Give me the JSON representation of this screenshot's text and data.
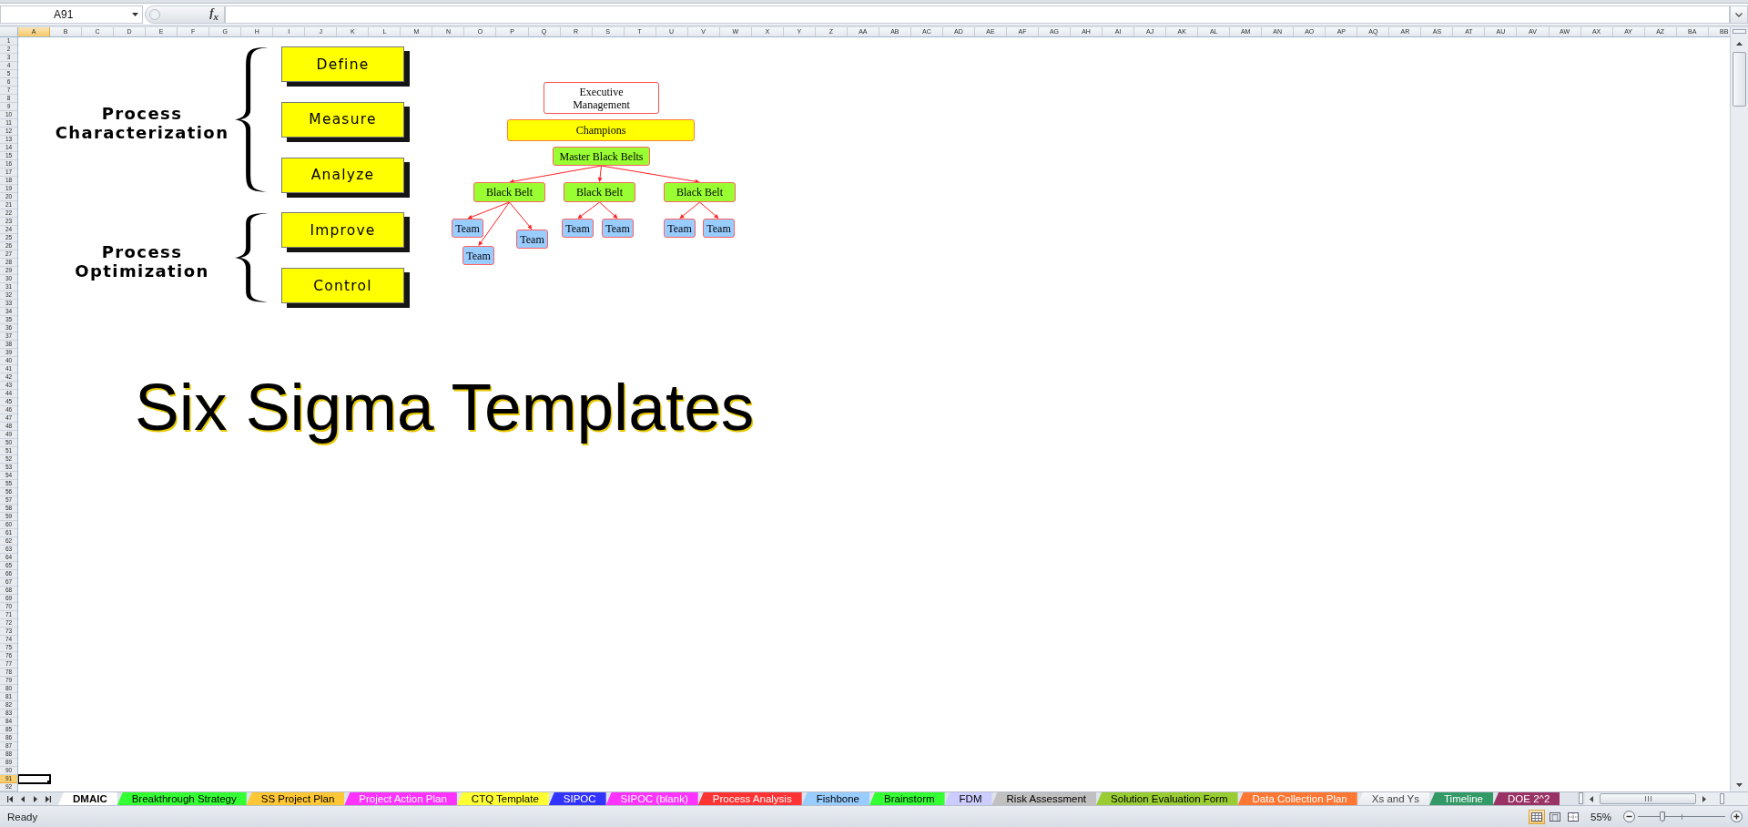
{
  "formula_bar": {
    "name_box": "A91",
    "function_button": "f$_{x}$"
  },
  "column_headers": [
    {
      "label": "A",
      "selected": true
    },
    {
      "label": "B",
      "selected": false
    },
    {
      "label": "C",
      "selected": false
    },
    {
      "label": "D",
      "selected": false
    },
    {
      "label": "E",
      "selected": false
    },
    {
      "label": "F",
      "selected": false
    },
    {
      "label": "G",
      "selected": false
    },
    {
      "label": "H",
      "selected": false
    },
    {
      "label": "I",
      "selected": false
    },
    {
      "label": "J",
      "selected": false
    },
    {
      "label": "K",
      "selected": false
    },
    {
      "label": "L",
      "selected": false
    },
    {
      "label": "M",
      "selected": false
    },
    {
      "label": "N",
      "selected": false
    },
    {
      "label": "O",
      "selected": false
    },
    {
      "label": "P",
      "selected": false
    },
    {
      "label": "Q",
      "selected": false
    },
    {
      "label": "R",
      "selected": false
    },
    {
      "label": "S",
      "selected": false
    },
    {
      "label": "T",
      "selected": false
    },
    {
      "label": "U",
      "selected": false
    },
    {
      "label": "V",
      "selected": false
    },
    {
      "label": "W",
      "selected": false
    },
    {
      "label": "X",
      "selected": false
    },
    {
      "label": "Y",
      "selected": false
    },
    {
      "label": "Z",
      "selected": false
    },
    {
      "label": "AA",
      "selected": false
    },
    {
      "label": "AB",
      "selected": false
    },
    {
      "label": "AC",
      "selected": false
    },
    {
      "label": "AD",
      "selected": false
    },
    {
      "label": "AE",
      "selected": false
    },
    {
      "label": "AF",
      "selected": false
    },
    {
      "label": "AG",
      "selected": false
    },
    {
      "label": "AH",
      "selected": false
    },
    {
      "label": "AI",
      "selected": false
    },
    {
      "label": "AJ",
      "selected": false
    },
    {
      "label": "AK",
      "selected": false
    },
    {
      "label": "AL",
      "selected": false
    },
    {
      "label": "AM",
      "selected": false
    },
    {
      "label": "AN",
      "selected": false
    },
    {
      "label": "AO",
      "selected": false
    },
    {
      "label": "AP",
      "selected": false
    },
    {
      "label": "AQ",
      "selected": false
    },
    {
      "label": "AR",
      "selected": false
    },
    {
      "label": "AS",
      "selected": false
    },
    {
      "label": "AT",
      "selected": false
    },
    {
      "label": "AU",
      "selected": false
    },
    {
      "label": "AV",
      "selected": false
    },
    {
      "label": "AW",
      "selected": false
    },
    {
      "label": "AX",
      "selected": false
    },
    {
      "label": "AY",
      "selected": false
    },
    {
      "label": "AZ",
      "selected": false
    },
    {
      "label": "BA",
      "selected": false
    },
    {
      "label": "BB",
      "selected": false
    }
  ],
  "row_headers": [
    {
      "label": "1",
      "selected": false
    },
    {
      "label": "2",
      "selected": false
    },
    {
      "label": "3",
      "selected": false
    },
    {
      "label": "4",
      "selected": false
    },
    {
      "label": "5",
      "selected": false
    },
    {
      "label": "6",
      "selected": false
    },
    {
      "label": "7",
      "selected": false
    },
    {
      "label": "8",
      "selected": false
    },
    {
      "label": "9",
      "selected": false
    },
    {
      "label": "10",
      "selected": false
    },
    {
      "label": "11",
      "selected": false
    },
    {
      "label": "12",
      "selected": false
    },
    {
      "label": "13",
      "selected": false
    },
    {
      "label": "14",
      "selected": false
    },
    {
      "label": "15",
      "selected": false
    },
    {
      "label": "16",
      "selected": false
    },
    {
      "label": "17",
      "selected": false
    },
    {
      "label": "18",
      "selected": false
    },
    {
      "label": "19",
      "selected": false
    },
    {
      "label": "20",
      "selected": false
    },
    {
      "label": "21",
      "selected": false
    },
    {
      "label": "22",
      "selected": false
    },
    {
      "label": "23",
      "selected": false
    },
    {
      "label": "24",
      "selected": false
    },
    {
      "label": "25",
      "selected": false
    },
    {
      "label": "26",
      "selected": false
    },
    {
      "label": "27",
      "selected": false
    },
    {
      "label": "28",
      "selected": false
    },
    {
      "label": "29",
      "selected": false
    },
    {
      "label": "30",
      "selected": false
    },
    {
      "label": "31",
      "selected": false
    },
    {
      "label": "32",
      "selected": false
    },
    {
      "label": "33",
      "selected": false
    },
    {
      "label": "34",
      "selected": false
    },
    {
      "label": "35",
      "selected": false
    },
    {
      "label": "36",
      "selected": false
    },
    {
      "label": "37",
      "selected": false
    },
    {
      "label": "38",
      "selected": false
    },
    {
      "label": "39",
      "selected": false
    },
    {
      "label": "40",
      "selected": false
    },
    {
      "label": "41",
      "selected": false
    },
    {
      "label": "42",
      "selected": false
    },
    {
      "label": "43",
      "selected": false
    },
    {
      "label": "44",
      "selected": false
    },
    {
      "label": "45",
      "selected": false
    },
    {
      "label": "46",
      "selected": false
    },
    {
      "label": "47",
      "selected": false
    },
    {
      "label": "48",
      "selected": false
    },
    {
      "label": "49",
      "selected": false
    },
    {
      "label": "50",
      "selected": false
    },
    {
      "label": "51",
      "selected": false
    },
    {
      "label": "52",
      "selected": false
    },
    {
      "label": "53",
      "selected": false
    },
    {
      "label": "54",
      "selected": false
    },
    {
      "label": "55",
      "selected": false
    },
    {
      "label": "56",
      "selected": false
    },
    {
      "label": "57",
      "selected": false
    },
    {
      "label": "58",
      "selected": false
    },
    {
      "label": "59",
      "selected": false
    },
    {
      "label": "60",
      "selected": false
    },
    {
      "label": "61",
      "selected": false
    },
    {
      "label": "62",
      "selected": false
    },
    {
      "label": "63",
      "selected": false
    },
    {
      "label": "64",
      "selected": false
    },
    {
      "label": "65",
      "selected": false
    },
    {
      "label": "66",
      "selected": false
    },
    {
      "label": "67",
      "selected": false
    },
    {
      "label": "68",
      "selected": false
    },
    {
      "label": "69",
      "selected": false
    },
    {
      "label": "70",
      "selected": false
    },
    {
      "label": "71",
      "selected": false
    },
    {
      "label": "72",
      "selected": false
    },
    {
      "label": "73",
      "selected": false
    },
    {
      "label": "74",
      "selected": false
    },
    {
      "label": "75",
      "selected": false
    },
    {
      "label": "76",
      "selected": false
    },
    {
      "label": "77",
      "selected": false
    },
    {
      "label": "78",
      "selected": false
    },
    {
      "label": "79",
      "selected": false
    },
    {
      "label": "80",
      "selected": false
    },
    {
      "label": "81",
      "selected": false
    },
    {
      "label": "82",
      "selected": false
    },
    {
      "label": "83",
      "selected": false
    },
    {
      "label": "84",
      "selected": false
    },
    {
      "label": "85",
      "selected": false
    },
    {
      "label": "86",
      "selected": false
    },
    {
      "label": "87",
      "selected": false
    },
    {
      "label": "88",
      "selected": false
    },
    {
      "label": "89",
      "selected": false
    },
    {
      "label": "90",
      "selected": false
    },
    {
      "label": "91",
      "selected": true
    },
    {
      "label": "92",
      "selected": false
    }
  ],
  "sheet": {
    "phase_groups": [
      {
        "label": "Process Characterization",
        "phases": [
          "Define",
          "Measure",
          "Analyze"
        ]
      },
      {
        "label": "Process Optimization",
        "phases": [
          "Improve",
          "Control"
        ]
      }
    ],
    "org_chart": {
      "executive": "Executive Management",
      "champions": "Champions",
      "master_black_belts": "Master Black Belts",
      "black_belts": [
        {
          "label": "Black Belt",
          "teams": [
            "Team",
            "Team",
            "Team"
          ]
        },
        {
          "label": "Black Belt",
          "teams": [
            "Team",
            "Team"
          ]
        },
        {
          "label": "Black Belt",
          "teams": [
            "Team",
            "Team"
          ]
        }
      ]
    },
    "title": "Six Sigma Templates"
  },
  "sheet_tabs": [
    {
      "label": "DMAIC",
      "selected": true
    },
    {
      "label": "Breakthrough Strategy",
      "selected": false,
      "color": "#33ff33"
    },
    {
      "label": "SS Project Plan",
      "selected": false,
      "color": "#ffc635"
    },
    {
      "label": "Project Action Plan",
      "selected": false,
      "color": "#ff33ff"
    },
    {
      "label": "CTQ Template",
      "selected": false,
      "color": "#ffff33"
    },
    {
      "label": "SIPOC",
      "selected": false,
      "color": "#3333ff"
    },
    {
      "label": "SIPOC (blank)",
      "selected": false,
      "color": "#ff33ff"
    },
    {
      "label": "Process Analysis",
      "selected": false,
      "color": "#ff3333"
    },
    {
      "label": "Fishbone",
      "selected": false,
      "color": "#99ccff"
    },
    {
      "label": "Brainstorm",
      "selected": false,
      "color": "#33ff33"
    },
    {
      "label": "FDM",
      "selected": false,
      "color": "#ccccff"
    },
    {
      "label": "Risk Assessment",
      "selected": false,
      "color": "#c0c0c0"
    },
    {
      "label": "Solution Evaluation Form",
      "selected": false,
      "color": "#99cc33"
    },
    {
      "label": "Data Collection Plan",
      "selected": false,
      "color": "#ff7733"
    },
    {
      "label": "Xs and Ys",
      "selected": false
    },
    {
      "label": "Timeline",
      "selected": false,
      "color": "#339966"
    },
    {
      "label": "DOE 2^2",
      "selected": false,
      "color": "#993366"
    }
  ],
  "status_bar": {
    "status": "Ready",
    "views": [
      {
        "kind": "normal",
        "selected": true
      },
      {
        "kind": "page_layout",
        "selected": false
      },
      {
        "kind": "page_break_preview",
        "selected": false
      }
    ],
    "zoom": {
      "label": "55%",
      "level": 0.28
    }
  }
}
